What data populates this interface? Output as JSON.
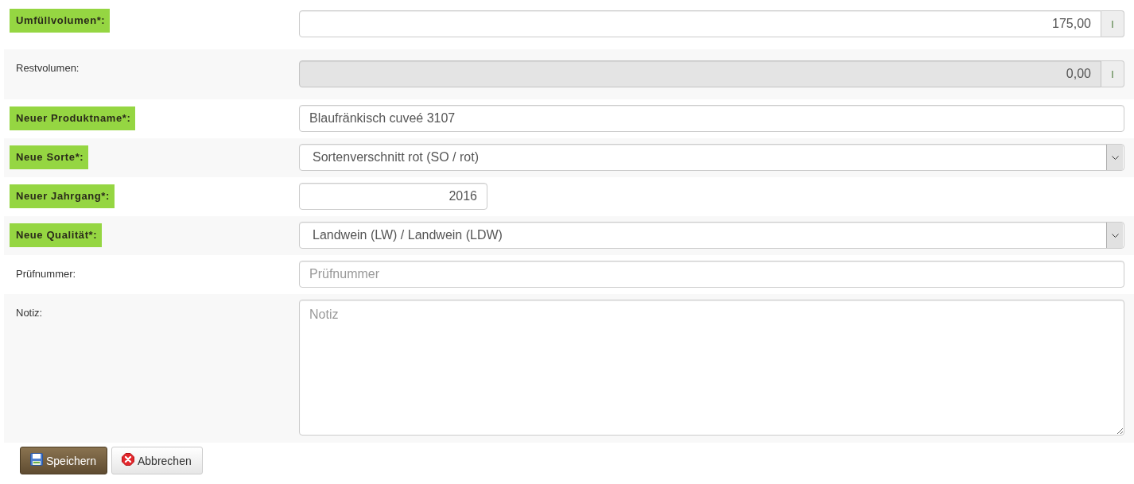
{
  "fields": [
    {
      "kind": "unit",
      "label": "Umfüllvolumen*:",
      "highlighted": true,
      "disabled": false,
      "value": "175,00",
      "unit": "l"
    },
    {
      "kind": "unit",
      "label": "Restvolumen:",
      "highlighted": false,
      "disabled": true,
      "value": "0,00",
      "unit": "l"
    },
    {
      "kind": "text",
      "label": "Neuer Produktname*:",
      "highlighted": true,
      "disabled": false,
      "value": "Blaufränkisch cuveé 3107"
    },
    {
      "kind": "select",
      "label": "Neue Sorte*:",
      "highlighted": true,
      "disabled": false,
      "value": "Sortenverschnitt rot (SO / rot)"
    },
    {
      "kind": "number",
      "label": "Neuer Jahrgang*:",
      "highlighted": true,
      "disabled": false,
      "value": "2016"
    },
    {
      "kind": "select",
      "label": "Neue Qualität*:",
      "highlighted": true,
      "disabled": false,
      "value": "Landwein (LW) / Landwein (LDW)"
    },
    {
      "kind": "text",
      "label": "Prüfnummer:",
      "highlighted": false,
      "disabled": false,
      "placeholder": "Prüfnummer"
    },
    {
      "kind": "textarea",
      "label": "Notiz:",
      "highlighted": false,
      "disabled": false,
      "placeholder": "Notiz"
    }
  ],
  "buttons": [
    {
      "kind": "save",
      "label": "Speichern"
    },
    {
      "kind": "cancel",
      "label": "Abbrechen"
    }
  ]
}
